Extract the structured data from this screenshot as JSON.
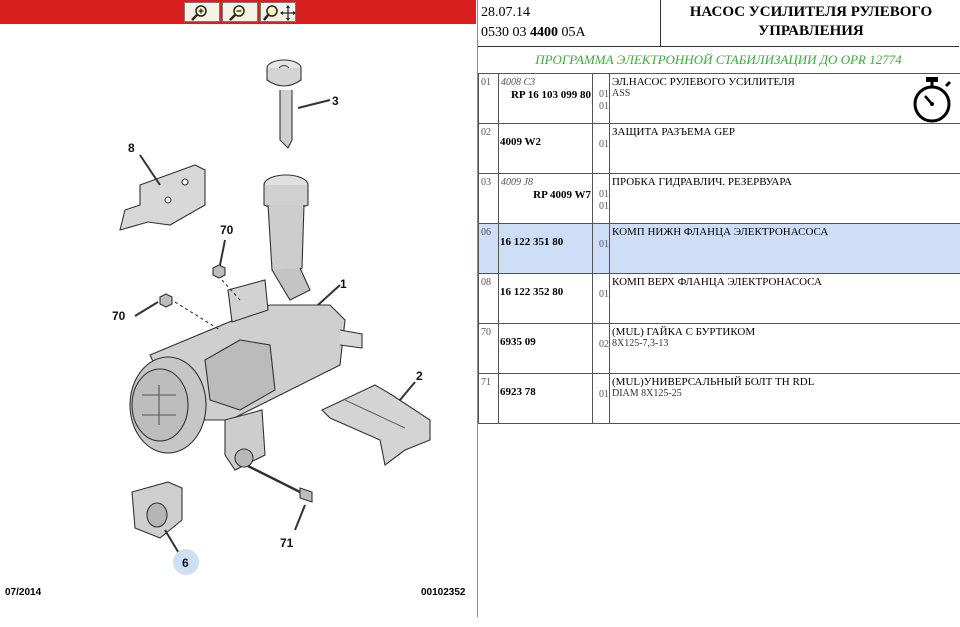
{
  "header": {
    "date": "28.07.14",
    "code_prefix": "0530 03 ",
    "code_bold": "4400",
    "code_suffix": " 05A",
    "title": "НАСОС УСИЛИТЕЛЯ РУЛЕВОГО УПРАВЛЕНИЯ"
  },
  "program": "ПРОГРАММА ЭЛЕКТРОННОЙ СТАБИЛИЗАЦИИ ДО OPR 12774",
  "toolbar": {
    "zoom_in": "zoom-in-icon",
    "zoom_out": "zoom-out-icon",
    "zoom_move": "zoom-pan-icon"
  },
  "diagram": {
    "labels": [
      "1",
      "2",
      "3",
      "6",
      "8",
      "70",
      "70",
      "71"
    ],
    "date": "07/2014",
    "ref": "00102352"
  },
  "parts": [
    {
      "pos": "01",
      "code_small": "4008 C3",
      "ref": "RP 16 103 099 80",
      "qty_a": "01",
      "qty_b": "01",
      "name": "ЭЛ.НАСОС РУЛЕВОГО УСИЛИТЕЛЯ",
      "sub": "ASS",
      "highlight": false
    },
    {
      "pos": "02",
      "code_small": "",
      "ref": "4009 W2",
      "qty_a": "",
      "qty_b": "01",
      "name": "ЗАЩИТА РАЗЪЕМА GEP",
      "sub": "",
      "highlight": false
    },
    {
      "pos": "03",
      "code_small": "4009 J8",
      "ref": "RP 4009 W7",
      "qty_a": "01",
      "qty_b": "01",
      "name": "ПРОБКА ГИДРАВЛИЧ. РЕЗЕРВУАРА",
      "sub": "",
      "highlight": false
    },
    {
      "pos": "06",
      "code_small": "",
      "ref": "16 122 351 80",
      "qty_a": "",
      "qty_b": "01",
      "name": "КОМП НИЖН ФЛАНЦА ЭЛЕКТРОНАСОСА",
      "sub": "",
      "highlight": true
    },
    {
      "pos": "08",
      "code_small": "",
      "ref": "16 122 352 80",
      "qty_a": "",
      "qty_b": "01",
      "name": "КОМП ВЕРХ ФЛАНЦА ЭЛЕКТРОНАСОСА",
      "sub": "",
      "highlight": false
    },
    {
      "pos": "70",
      "code_small": "",
      "ref": "6935 09",
      "qty_a": "",
      "qty_b": "02",
      "name": "(MUL) ГАЙКА С БУРТИКОМ",
      "sub": "8X125-7,3-13",
      "highlight": false
    },
    {
      "pos": "71",
      "code_small": "",
      "ref": "6923 78",
      "qty_a": "",
      "qty_b": "01",
      "name": "(MUL)УНИВЕРСАЛЬНЫЙ БОЛТ TH RDL",
      "sub": "DIAM 8X125-25",
      "highlight": false
    }
  ]
}
